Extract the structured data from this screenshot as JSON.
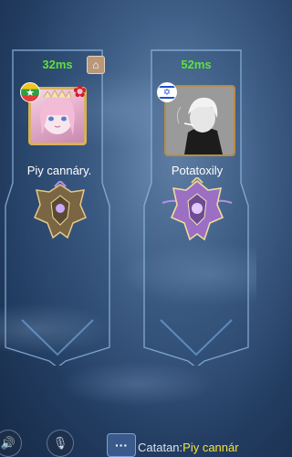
{
  "players": [
    {
      "ping": "32ms",
      "name": "Piy cannáry.",
      "flag": "myanmar-flag-icon"
    },
    {
      "ping": "52ms",
      "name": "Potatoxily",
      "flag": "israel-flag-icon"
    }
  ],
  "chat": {
    "prefix": "Catatan:",
    "sender": "Piy cannár"
  },
  "colors": {
    "ping": "#5de03c",
    "chat_sender": "#f5e23a",
    "frame": "#8fb6e0"
  }
}
